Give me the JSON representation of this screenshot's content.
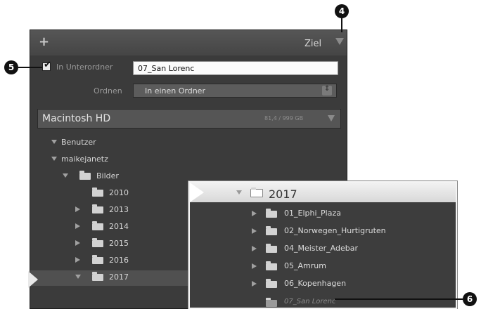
{
  "panel": {
    "plus_icon": "+",
    "header_title": "Ziel",
    "subfolder": {
      "checked": true,
      "label": "In Unterordner",
      "value": "07_San Lorenc"
    },
    "organize": {
      "label": "Ordnen",
      "value": "In einen Ordner"
    },
    "volume": {
      "name": "Macintosh HD",
      "size": "81,4 / 999 GB"
    },
    "tree": [
      {
        "label": "Benutzer",
        "indent": 0,
        "expander": "down",
        "folder": false
      },
      {
        "label": "maikejanetz",
        "indent": 1,
        "expander": "down",
        "folder": false
      },
      {
        "label": "Bilder",
        "indent": 2,
        "expander": "down",
        "folder": true
      },
      {
        "label": "2010",
        "indent": 3,
        "expander": "none",
        "folder": true
      },
      {
        "label": "2013",
        "indent": 3,
        "expander": "right",
        "folder": true
      },
      {
        "label": "2014",
        "indent": 3,
        "expander": "right",
        "folder": true
      },
      {
        "label": "2015",
        "indent": 3,
        "expander": "right",
        "folder": true
      },
      {
        "label": "2016",
        "indent": 3,
        "expander": "right",
        "folder": true
      },
      {
        "label": "2017",
        "indent": 3,
        "expander": "down",
        "folder": true
      }
    ]
  },
  "overlay": {
    "header": "2017",
    "items": [
      "01_Elphi_Plaza",
      "02_Norwegen_Hurtigruten",
      "04_Meister_Adebar",
      "05_Amrum",
      "06_Kopenhagen"
    ],
    "new_folder": "07_San Lorenc"
  },
  "callouts": {
    "four": "4",
    "five": "5",
    "six": "6"
  }
}
